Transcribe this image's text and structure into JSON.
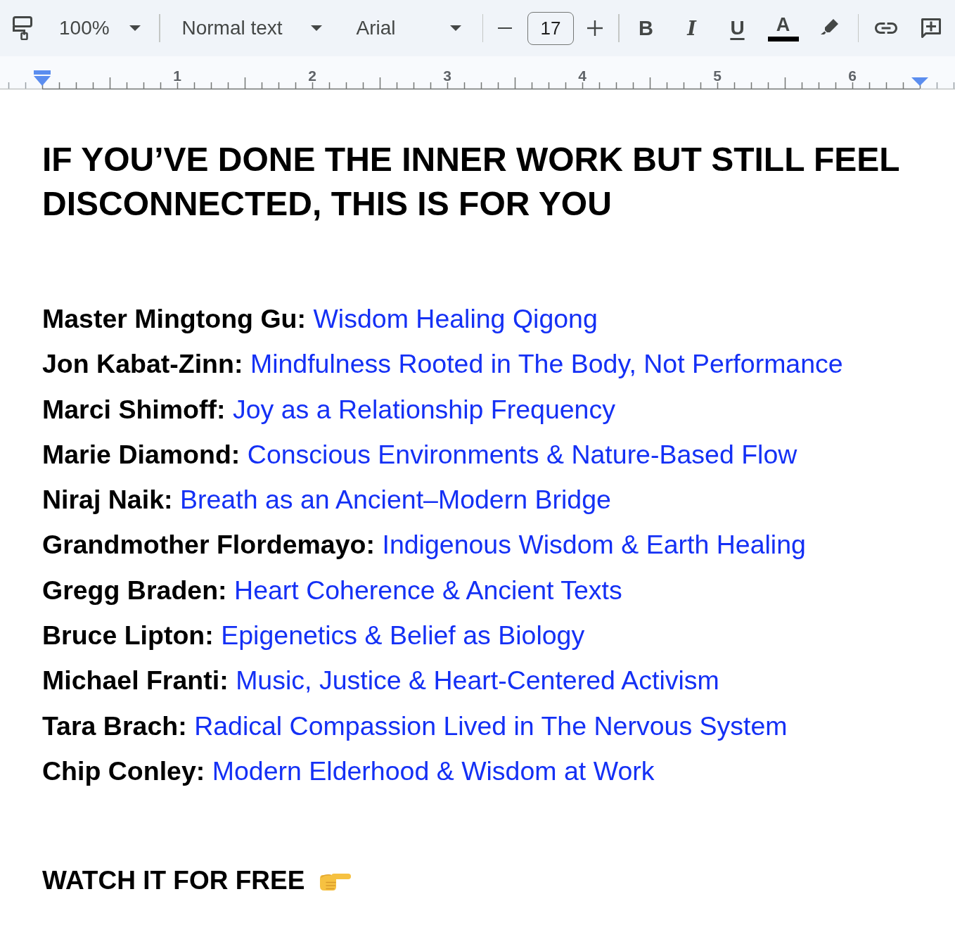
{
  "toolbar": {
    "zoom": "100%",
    "paragraph_style": "Normal text",
    "font": "Arial",
    "font_size": "17",
    "format_buttons": [
      {
        "kind": "bold",
        "label": "B"
      },
      {
        "kind": "italic",
        "label": "I"
      },
      {
        "kind": "underline",
        "label": "U"
      },
      {
        "kind": "text_color",
        "label": "A",
        "color": "#000000"
      }
    ]
  },
  "ruler": {
    "labels": [
      "1",
      "2",
      "3",
      "4",
      "5",
      "6"
    ]
  },
  "document": {
    "title": "IF YOU’VE DONE THE INNER WORK BUT STILL FEEL DISCONNECTED, THIS IS FOR YOU",
    "speakers": [
      {
        "name": "Master Mingtong Gu:",
        "link": "Wisdom Healing Qigong"
      },
      {
        "name": "Jon Kabat-Zinn:",
        "link": "Mindfulness Rooted in The Body, Not Performance"
      },
      {
        "name": "Marci Shimoff:",
        "link": "Joy as a Relationship Frequency"
      },
      {
        "name": "Marie Diamond:",
        "link": "Conscious Environments & Nature-Based Flow"
      },
      {
        "name": "Niraj Naik:",
        "link": "Breath as an Ancient–Modern Bridge"
      },
      {
        "name": "Grandmother Flordemayo:",
        "link": "Indigenous Wisdom & Earth Healing"
      },
      {
        "name": "Gregg Braden:",
        "link": "Heart Coherence & Ancient Texts"
      },
      {
        "name": "Bruce Lipton:",
        "link": "Epigenetics & Belief as Biology"
      },
      {
        "name": "Michael Franti:",
        "link": "Music, Justice & Heart-Centered Activism"
      },
      {
        "name": "Tara Brach:",
        "link": "Radical Compassion Lived in The Nervous System"
      },
      {
        "name": "Chip Conley:",
        "link": "Modern Elderhood & Wisdom at Work"
      }
    ],
    "call_to_action": "WATCH IT FOR FREE"
  }
}
